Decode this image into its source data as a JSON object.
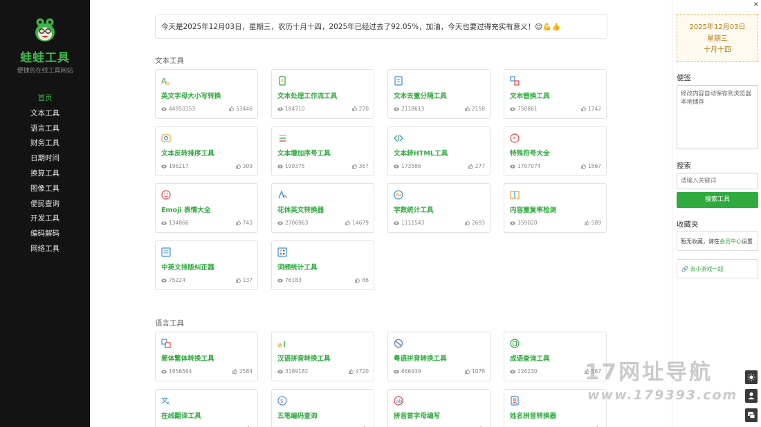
{
  "sidebar": {
    "brand": "蛙蛙工具",
    "slogan": "便捷的在线工具网站",
    "nav": [
      "首页",
      "文本工具",
      "语言工具",
      "财务工具",
      "日期时间",
      "换算工具",
      "图像工具",
      "便民查询",
      "开发工具",
      "编码解码",
      "网络工具"
    ],
    "active_index": 0
  },
  "notice": "今天是2025年12月03日，星期三，农历十月十四，2025年已经过去了92.05%，加油，今天也要过得充实有意义！😊💪👍",
  "sections": [
    {
      "title": "文本工具",
      "cards": [
        {
          "name": "英文字母大小写转换",
          "views": "44950153",
          "likes": "53446",
          "icon": "letter-case-icon"
        },
        {
          "name": "文本处理工作流工具",
          "views": "184710",
          "likes": "270",
          "icon": "workflow-icon"
        },
        {
          "name": "文本去重分隔工具",
          "views": "2118613",
          "likes": "2158",
          "icon": "document-icon"
        },
        {
          "name": "文本替换工具",
          "views": "750861",
          "likes": "1742",
          "icon": "replace-icon"
        },
        {
          "name": "文本反转排序工具",
          "views": "196217",
          "likes": "309",
          "icon": "reverse-icon"
        },
        {
          "name": "文本增加序号工具",
          "views": "190375",
          "likes": "367",
          "icon": "numbered-list-icon"
        },
        {
          "name": "文本转HTML工具",
          "views": "173586",
          "likes": "277",
          "icon": "code-icon"
        },
        {
          "name": "特殊符号大全",
          "views": "1707074",
          "likes": "1867",
          "icon": "asterisk-icon"
        },
        {
          "name": "Emoji 表情大全",
          "views": "134866",
          "likes": "743",
          "icon": "smiley-icon"
        },
        {
          "name": "花体英文转换器",
          "views": "2706963",
          "likes": "14679",
          "icon": "fancy-text-icon"
        },
        {
          "name": "字数统计工具",
          "views": "1111543",
          "likes": "2693",
          "icon": "wave-icon"
        },
        {
          "name": "内容重复率检测",
          "views": "359020",
          "likes": "589",
          "icon": "compare-icon"
        },
        {
          "name": "中英文排版纠正器",
          "views": "75224",
          "likes": "137",
          "icon": "layout-icon"
        },
        {
          "name": "词频统计工具",
          "views": "76183",
          "likes": "86",
          "icon": "grid-icon"
        }
      ]
    },
    {
      "title": "语言工具",
      "cards": [
        {
          "name": "简体繁体转换工具",
          "views": "1856564",
          "likes": "2584",
          "icon": "simplified-traditional-icon"
        },
        {
          "name": "汉语拼音转换工具",
          "views": "3189182",
          "likes": "4720",
          "icon": "pinyin-icon"
        },
        {
          "name": "粤语拼音转换工具",
          "views": "666939",
          "likes": "1078",
          "icon": "cantonese-icon"
        },
        {
          "name": "成语查询工具",
          "views": "226230",
          "likes": "567",
          "icon": "idiom-icon"
        },
        {
          "name": "在线翻译工具",
          "views": "",
          "likes": "",
          "icon": "translate-icon"
        },
        {
          "name": "五笔编码查询",
          "views": "",
          "likes": "",
          "icon": "wubi-icon"
        },
        {
          "name": "拼音首字母编写",
          "views": "",
          "likes": "",
          "icon": "initials-icon"
        },
        {
          "name": "姓名拼音转换器",
          "views": "",
          "likes": "",
          "icon": "name-pinyin-icon"
        }
      ]
    }
  ],
  "right_panel": {
    "close": "×",
    "date_line1": "2025年12月03日",
    "date_line2": "星期三",
    "date_line3": "十月十四",
    "memo_title": "便签",
    "memo_placeholder": "修改内容自动保存到浏览器本地储存",
    "search_title": "搜索",
    "search_placeholder": "请输入关键词",
    "search_button": "搜索工具",
    "fav_title": "收藏夹",
    "fav_text_before": "暂无收藏，请在",
    "fav_link": "会员中心",
    "fav_text_after": "设置",
    "game_link": "🔗 去小游戏一起"
  },
  "watermark": {
    "line1": "17网址导航",
    "line2": "www.179393.com"
  },
  "colors": {
    "brand_green": "#3cb54a",
    "card_title_green": "#2faa3e",
    "sidebar_bg": "#131313",
    "date_border": "#e2b35a"
  }
}
